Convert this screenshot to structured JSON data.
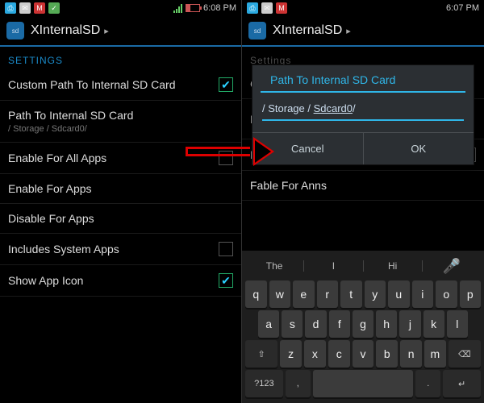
{
  "left": {
    "status": {
      "time": "6:08 PM"
    },
    "app_title": "XInternalSD",
    "section": "SETTINGS",
    "rows": {
      "custom_path": {
        "label": "Custom Path To Internal SD Card",
        "checked": true
      },
      "path": {
        "label": "Path To Internal SD Card",
        "sub": "/ Storage / Sdcard0/"
      },
      "enable_all": {
        "label": "Enable For All Apps",
        "checked": false
      },
      "enable_for": {
        "label": "Enable For Apps"
      },
      "disable_for": {
        "label": "Disable For Apps"
      },
      "include_sys": {
        "label": "Includes System Apps",
        "checked": false
      },
      "show_icon": {
        "label": "Show App Icon",
        "checked": true
      }
    }
  },
  "right": {
    "status": {
      "time": "6:07 PM"
    },
    "app_title": "XInternalSD",
    "section": "Settings",
    "bg_rows": {
      "cu": "Cu",
      "p": "P…",
      "enable_all": "Enable For All Apps",
      "enable_for": "Fable For Anns"
    },
    "dialog": {
      "title": "Path To Internal SD Card",
      "value_prefix": "/ Storage / ",
      "value_underlined": "Sdcard0",
      "value_suffix": "/",
      "cancel": "Cancel",
      "ok": "OK"
    },
    "keyboard": {
      "suggestions": [
        "The",
        "I",
        "Hi"
      ],
      "mic": "🎤",
      "rows": [
        [
          "q",
          "w",
          "e",
          "r",
          "t",
          "y",
          "u",
          "i",
          "o",
          "p"
        ],
        [
          "a",
          "s",
          "d",
          "f",
          "g",
          "h",
          "j",
          "k",
          "l"
        ],
        [
          "⇧",
          "z",
          "x",
          "c",
          "v",
          "b",
          "n",
          "m",
          "⌫"
        ],
        [
          "?123",
          ",",
          "␣",
          ".",
          "↵"
        ]
      ]
    }
  }
}
